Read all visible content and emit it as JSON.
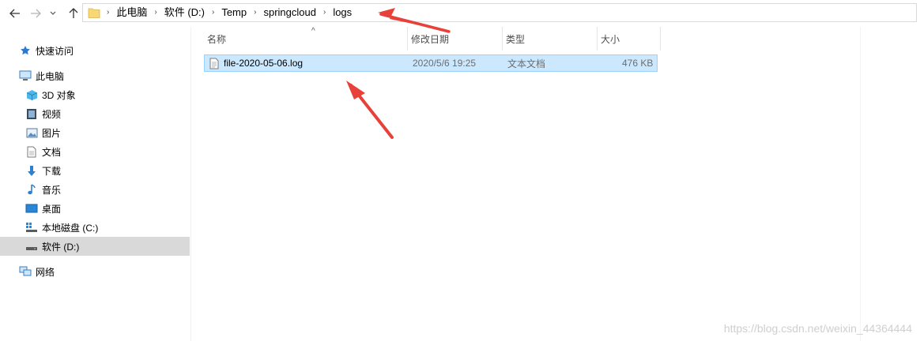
{
  "address": {
    "crumbs": [
      "此电脑",
      "软件 (D:)",
      "Temp",
      "springcloud",
      "logs"
    ]
  },
  "nav": {
    "quick_access": "快速访问",
    "this_pc": "此电脑",
    "items": [
      "3D 对象",
      "视频",
      "图片",
      "文档",
      "下载",
      "音乐",
      "桌面",
      "本地磁盘 (C:)",
      "软件 (D:)"
    ],
    "network": "网络"
  },
  "columns": {
    "name": "名称",
    "modified": "修改日期",
    "type": "类型",
    "size": "大小"
  },
  "files": [
    {
      "name": "file-2020-05-06.log",
      "modified": "2020/5/6 19:25",
      "type": "文本文档",
      "size": "476 KB"
    }
  ],
  "watermark": "https://blog.csdn.net/weixin_44364444",
  "colors": {
    "selection_fill": "#cce8ff",
    "selection_border": "#99d1ff",
    "annotation_arrow": "#e8413a"
  }
}
